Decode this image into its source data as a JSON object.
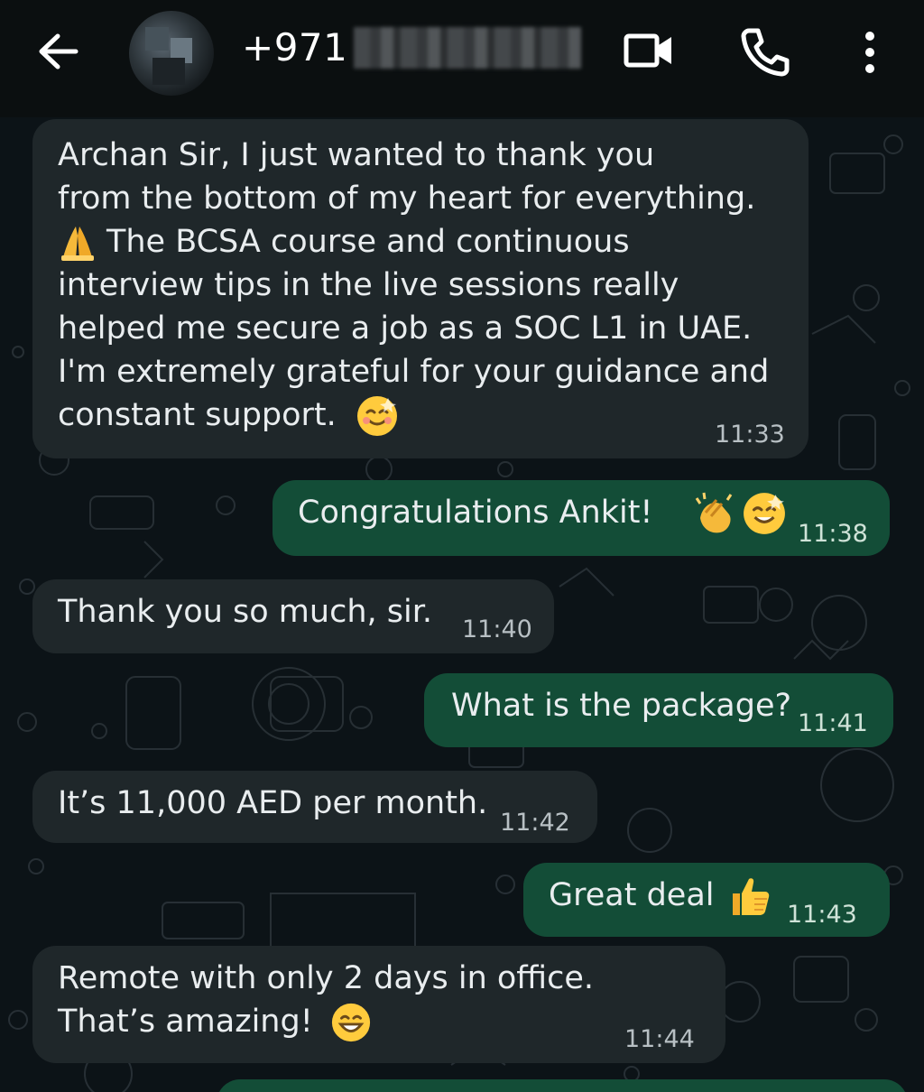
{
  "header": {
    "phone_prefix": "+971",
    "icons": [
      "back-arrow-icon",
      "avatar",
      "video-call-icon",
      "voice-call-icon",
      "more-options-icon"
    ]
  },
  "messages": [
    {
      "direction": "incoming",
      "lines": [
        "Archan Sir, I just wanted to thank you",
        "from the bottom of my heart for everything.",
        "The BCSA course and continuous",
        "interview tips in the live sessions really",
        "helped me secure a job as a SOC L1 in UAE.",
        "I'm extremely grateful for your guidance and",
        "constant support."
      ],
      "time": "11:33"
    },
    {
      "direction": "outgoing",
      "text": "Congratulations Ankit!",
      "time": "11:38"
    },
    {
      "direction": "incoming",
      "text": "Thank you so much, sir.",
      "time": "11:40"
    },
    {
      "direction": "outgoing",
      "text": "What is the package?",
      "time": "11:41"
    },
    {
      "direction": "incoming",
      "text": "It’s 11,000 AED per month.",
      "time": "11:42"
    },
    {
      "direction": "outgoing",
      "text": "Great deal",
      "time": "11:43"
    },
    {
      "direction": "incoming",
      "lines": [
        "Remote with only 2 days in office.",
        "That’s amazing!"
      ],
      "time": "11:44"
    }
  ],
  "colors": {
    "incoming_bubble": "#1f272a",
    "outgoing_bubble": "#134d37",
    "wallpaper": "#0c1317"
  }
}
